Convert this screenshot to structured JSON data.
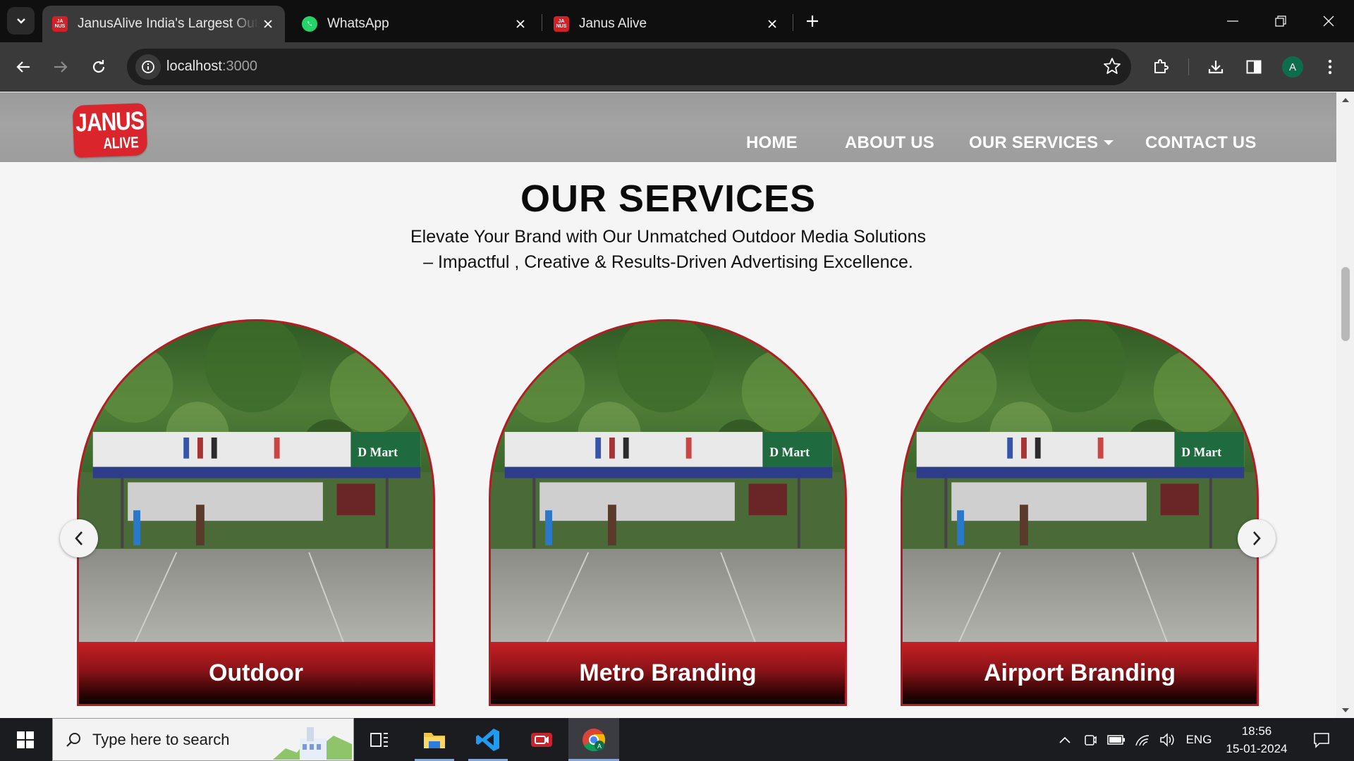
{
  "browser": {
    "tabs": [
      {
        "title": "JanusAlive India's Largest Outdoor Advertising",
        "active": true
      },
      {
        "title": "WhatsApp",
        "active": false
      },
      {
        "title": "Janus Alive",
        "active": false
      }
    ],
    "url_host": "localhost",
    "url_port": ":3000",
    "profile_initial": "A"
  },
  "site": {
    "logo": {
      "line1": "JANUS",
      "line2": "ALIVE"
    },
    "nav": {
      "home": "HOME",
      "about": "ABOUT US",
      "services": "OUR SERVICES",
      "contact": "CONTACT US"
    },
    "section": {
      "title": "OUR SERVICES",
      "subtitle_line1": "Elevate Your Brand with Our Unmatched Outdoor Media Solutions",
      "subtitle_line2": "– Impactful , Creative & Results-Driven Advertising Excellence."
    },
    "cards": [
      {
        "label": "Outdoor",
        "billboard_brand": "D Mart"
      },
      {
        "label": "Metro Branding",
        "billboard_brand": "D Mart"
      },
      {
        "label": "Airport Branding",
        "billboard_brand": "D Mart"
      }
    ],
    "brand_color": "#b51c22"
  },
  "taskbar": {
    "search_placeholder": "Type here to search",
    "language": "ENG",
    "time": "18:56",
    "date": "15-01-2024"
  }
}
